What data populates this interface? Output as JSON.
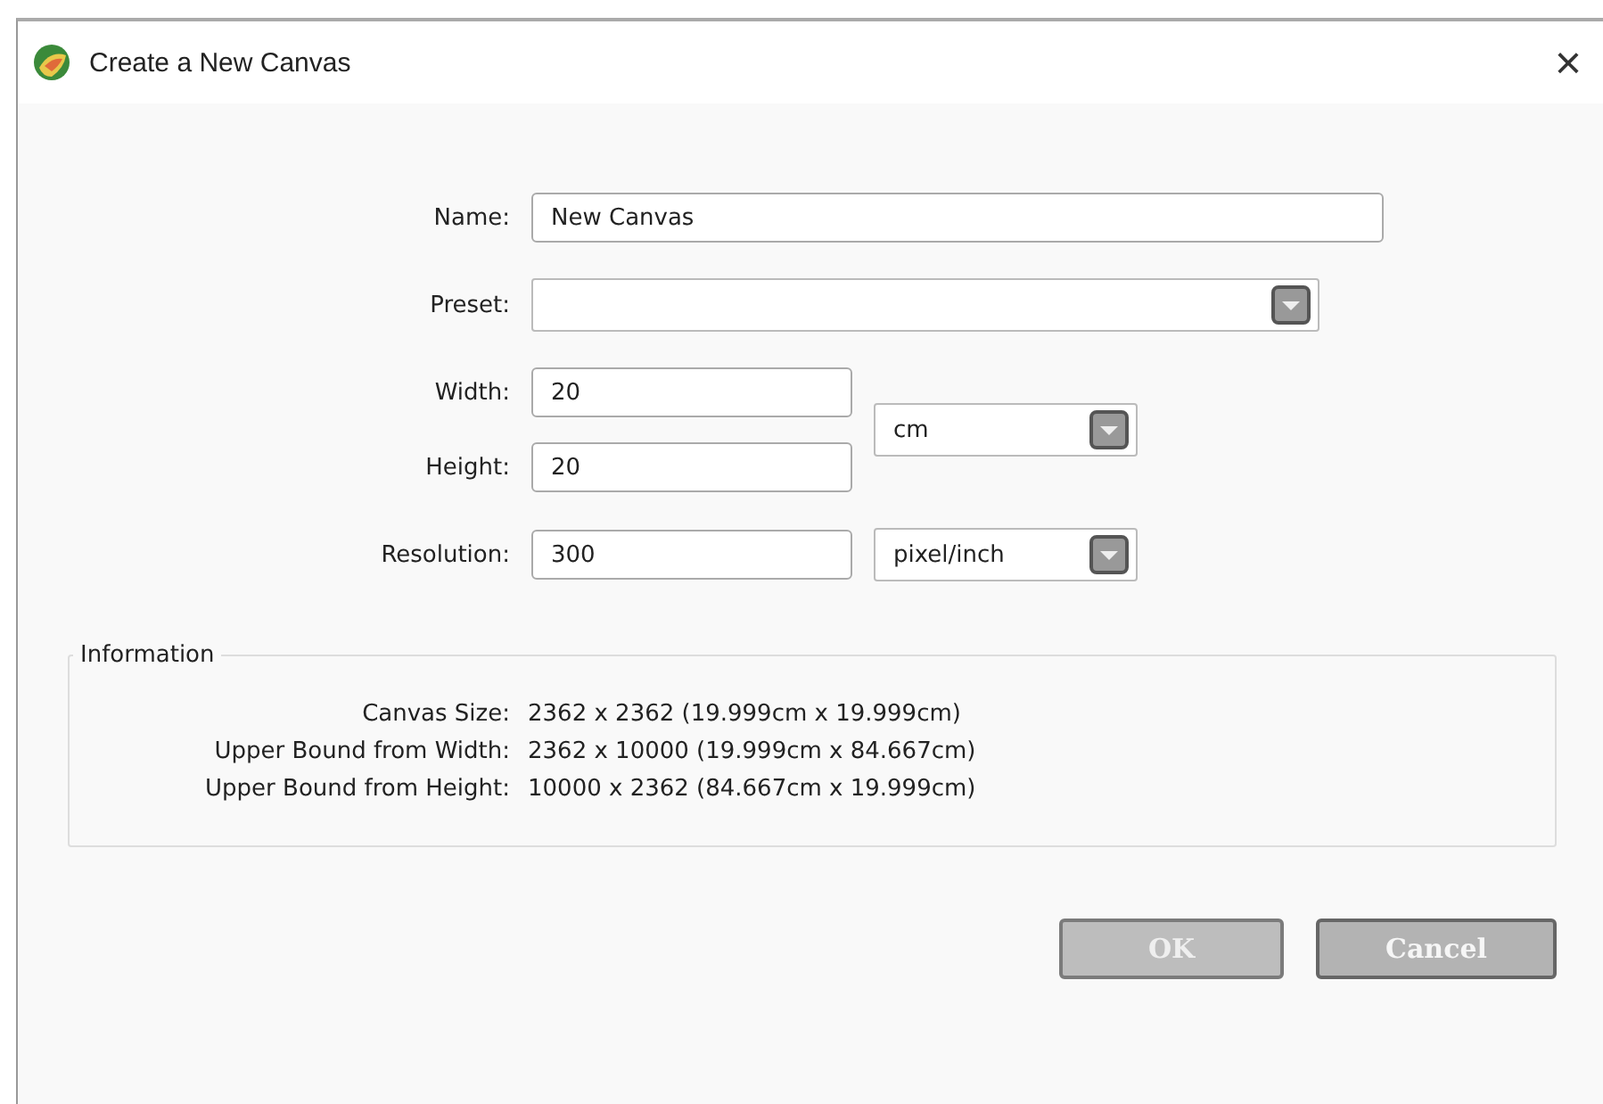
{
  "window": {
    "title": "Create a New Canvas",
    "close": "×"
  },
  "name": {
    "label": "Name:",
    "value": "New Canvas"
  },
  "preset": {
    "label": "Preset:"
  },
  "width": {
    "label": "Width:",
    "value": "20"
  },
  "height": {
    "label": "Height:",
    "value": "20"
  },
  "size_unit": {
    "value": "cm"
  },
  "resolution": {
    "label": "Resolution:",
    "value": "300"
  },
  "resolution_unit": {
    "value": "pixel/inch"
  },
  "information": {
    "title": "Information",
    "rows": [
      {
        "label": "Canvas Size:",
        "value": "2362 x 2362 (19.999cm x 19.999cm)"
      },
      {
        "label": "Upper Bound from Width:",
        "value": "2362 x 10000 (19.999cm x 84.667cm)"
      },
      {
        "label": "Upper Bound from Height:",
        "value": "10000 x 2362 (84.667cm x 19.999cm)"
      }
    ]
  },
  "buttons": [
    {
      "label": "OK",
      "disabled": true
    },
    {
      "label": "Cancel",
      "disabled": false
    }
  ]
}
